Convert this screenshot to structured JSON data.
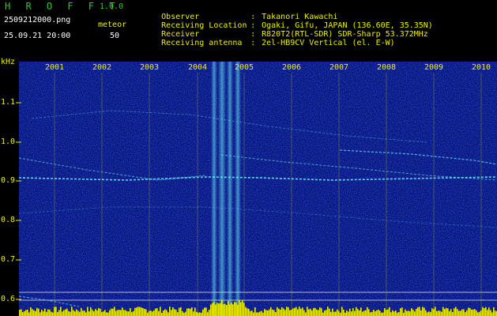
{
  "header": {
    "app_title": "H R O F F T",
    "version": "1.0.0",
    "filename": "2509212000.png",
    "datetime": "25.09.21 20:00",
    "meteor_label": "meteor",
    "meteor_count": "50"
  },
  "info": [
    {
      "key": "Observer",
      "value": "Takanori Kawachi"
    },
    {
      "key": "Receiving Location",
      "value": "Ogaki, Gifu, JAPAN (136.60E, 35.35N)"
    },
    {
      "key": "Receiver",
      "value": "R820T2(RTL-SDR) SDR-Sharp 53.372MHz"
    },
    {
      "key": "Receiving antenna",
      "value": "2el-HB9CV Vertical (el. E-W)"
    }
  ],
  "axis": {
    "unit": "kHz",
    "y_ticks": [
      "1.1",
      "1.0",
      "0.9",
      "0.8",
      "0.7",
      "0.6"
    ],
    "x_ticks": [
      "2001",
      "2002",
      "2003",
      "2004",
      "2005",
      "2006",
      "2007",
      "2008",
      "2009",
      "2010"
    ]
  },
  "colors": {
    "background": "#000000",
    "spectrogram": "#061079",
    "label_yellow": "#f0f000",
    "label_green": "#1fd21f",
    "signal_cyan": "#6ef4ff",
    "meteor_histogram": "#f0f000"
  },
  "signals": {
    "carrier_freq_khz": 0.91,
    "meteor_ping_bands_x": [
      2004.35,
      2004.5,
      2004.72,
      2004.87
    ]
  }
}
